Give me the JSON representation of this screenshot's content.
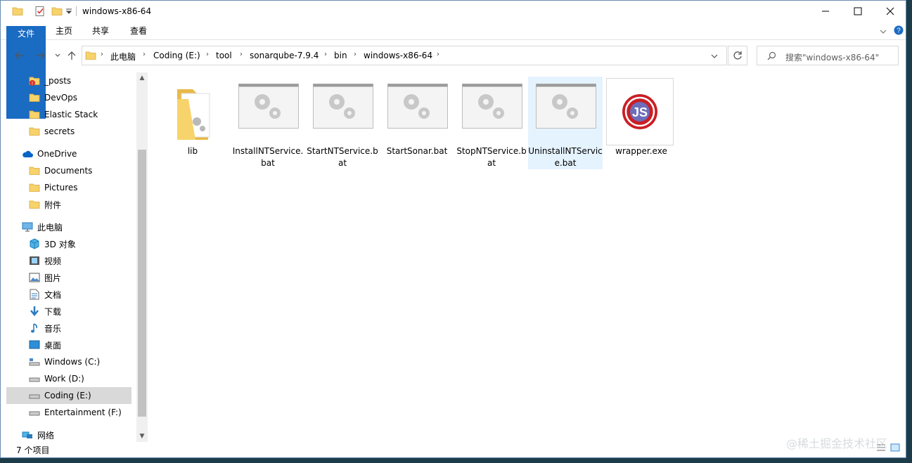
{
  "window": {
    "title": "windows-x86-64"
  },
  "ribbon": {
    "tabs": [
      {
        "label": "文件"
      },
      {
        "label": "主页"
      },
      {
        "label": "共享"
      },
      {
        "label": "查看"
      }
    ]
  },
  "address": {
    "crumbs": [
      "此电脑",
      "Coding (E:)",
      "tool",
      "sonarqube-7.9.4",
      "bin",
      "windows-x86-64"
    ]
  },
  "search": {
    "placeholder": "搜索\"windows-x86-64\""
  },
  "sidebar": {
    "items": [
      {
        "label": "_posts",
        "icon": "folder-alert-icon"
      },
      {
        "label": "DevOps",
        "icon": "folder-icon"
      },
      {
        "label": "Elastic Stack",
        "icon": "folder-icon"
      },
      {
        "label": "secrets",
        "icon": "folder-icon"
      },
      {
        "label": "OneDrive",
        "icon": "cloud-icon"
      },
      {
        "label": "Documents",
        "icon": "folder-icon"
      },
      {
        "label": "Pictures",
        "icon": "folder-icon"
      },
      {
        "label": "附件",
        "icon": "folder-icon"
      },
      {
        "label": "此电脑",
        "icon": "computer-icon"
      },
      {
        "label": "3D 对象",
        "icon": "cube-3d-icon"
      },
      {
        "label": "视频",
        "icon": "video-icon"
      },
      {
        "label": "图片",
        "icon": "picture-icon"
      },
      {
        "label": "文档",
        "icon": "document-icon"
      },
      {
        "label": "下载",
        "icon": "download-icon"
      },
      {
        "label": "音乐",
        "icon": "music-icon"
      },
      {
        "label": "桌面",
        "icon": "desktop-icon"
      },
      {
        "label": "Windows (C:)",
        "icon": "drive-c-icon"
      },
      {
        "label": "Work (D:)",
        "icon": "drive-icon"
      },
      {
        "label": "Coding (E:)",
        "icon": "drive-icon",
        "selected": true
      },
      {
        "label": "Entertainment (F:)",
        "icon": "drive-icon"
      },
      {
        "label": "网络",
        "icon": "network-icon"
      }
    ]
  },
  "files": [
    {
      "name": "lib",
      "type": "folder"
    },
    {
      "name": "InstallNTService.bat",
      "type": "bat"
    },
    {
      "name": "StartNTService.bat",
      "type": "bat"
    },
    {
      "name": "StartSonar.bat",
      "type": "bat"
    },
    {
      "name": "StopNTService.bat",
      "type": "bat"
    },
    {
      "name": "UninstallNTService.bat",
      "type": "bat",
      "selected": true
    },
    {
      "name": "wrapper.exe",
      "type": "exe"
    }
  ],
  "exe_logo_text": "JS",
  "status": {
    "item_count": "7 个项目"
  },
  "watermark": "@稀土掘金技术社区",
  "colors": {
    "accent": "#1a6bc2",
    "selection": "#e5f3ff",
    "folder": "#f6d36b"
  }
}
